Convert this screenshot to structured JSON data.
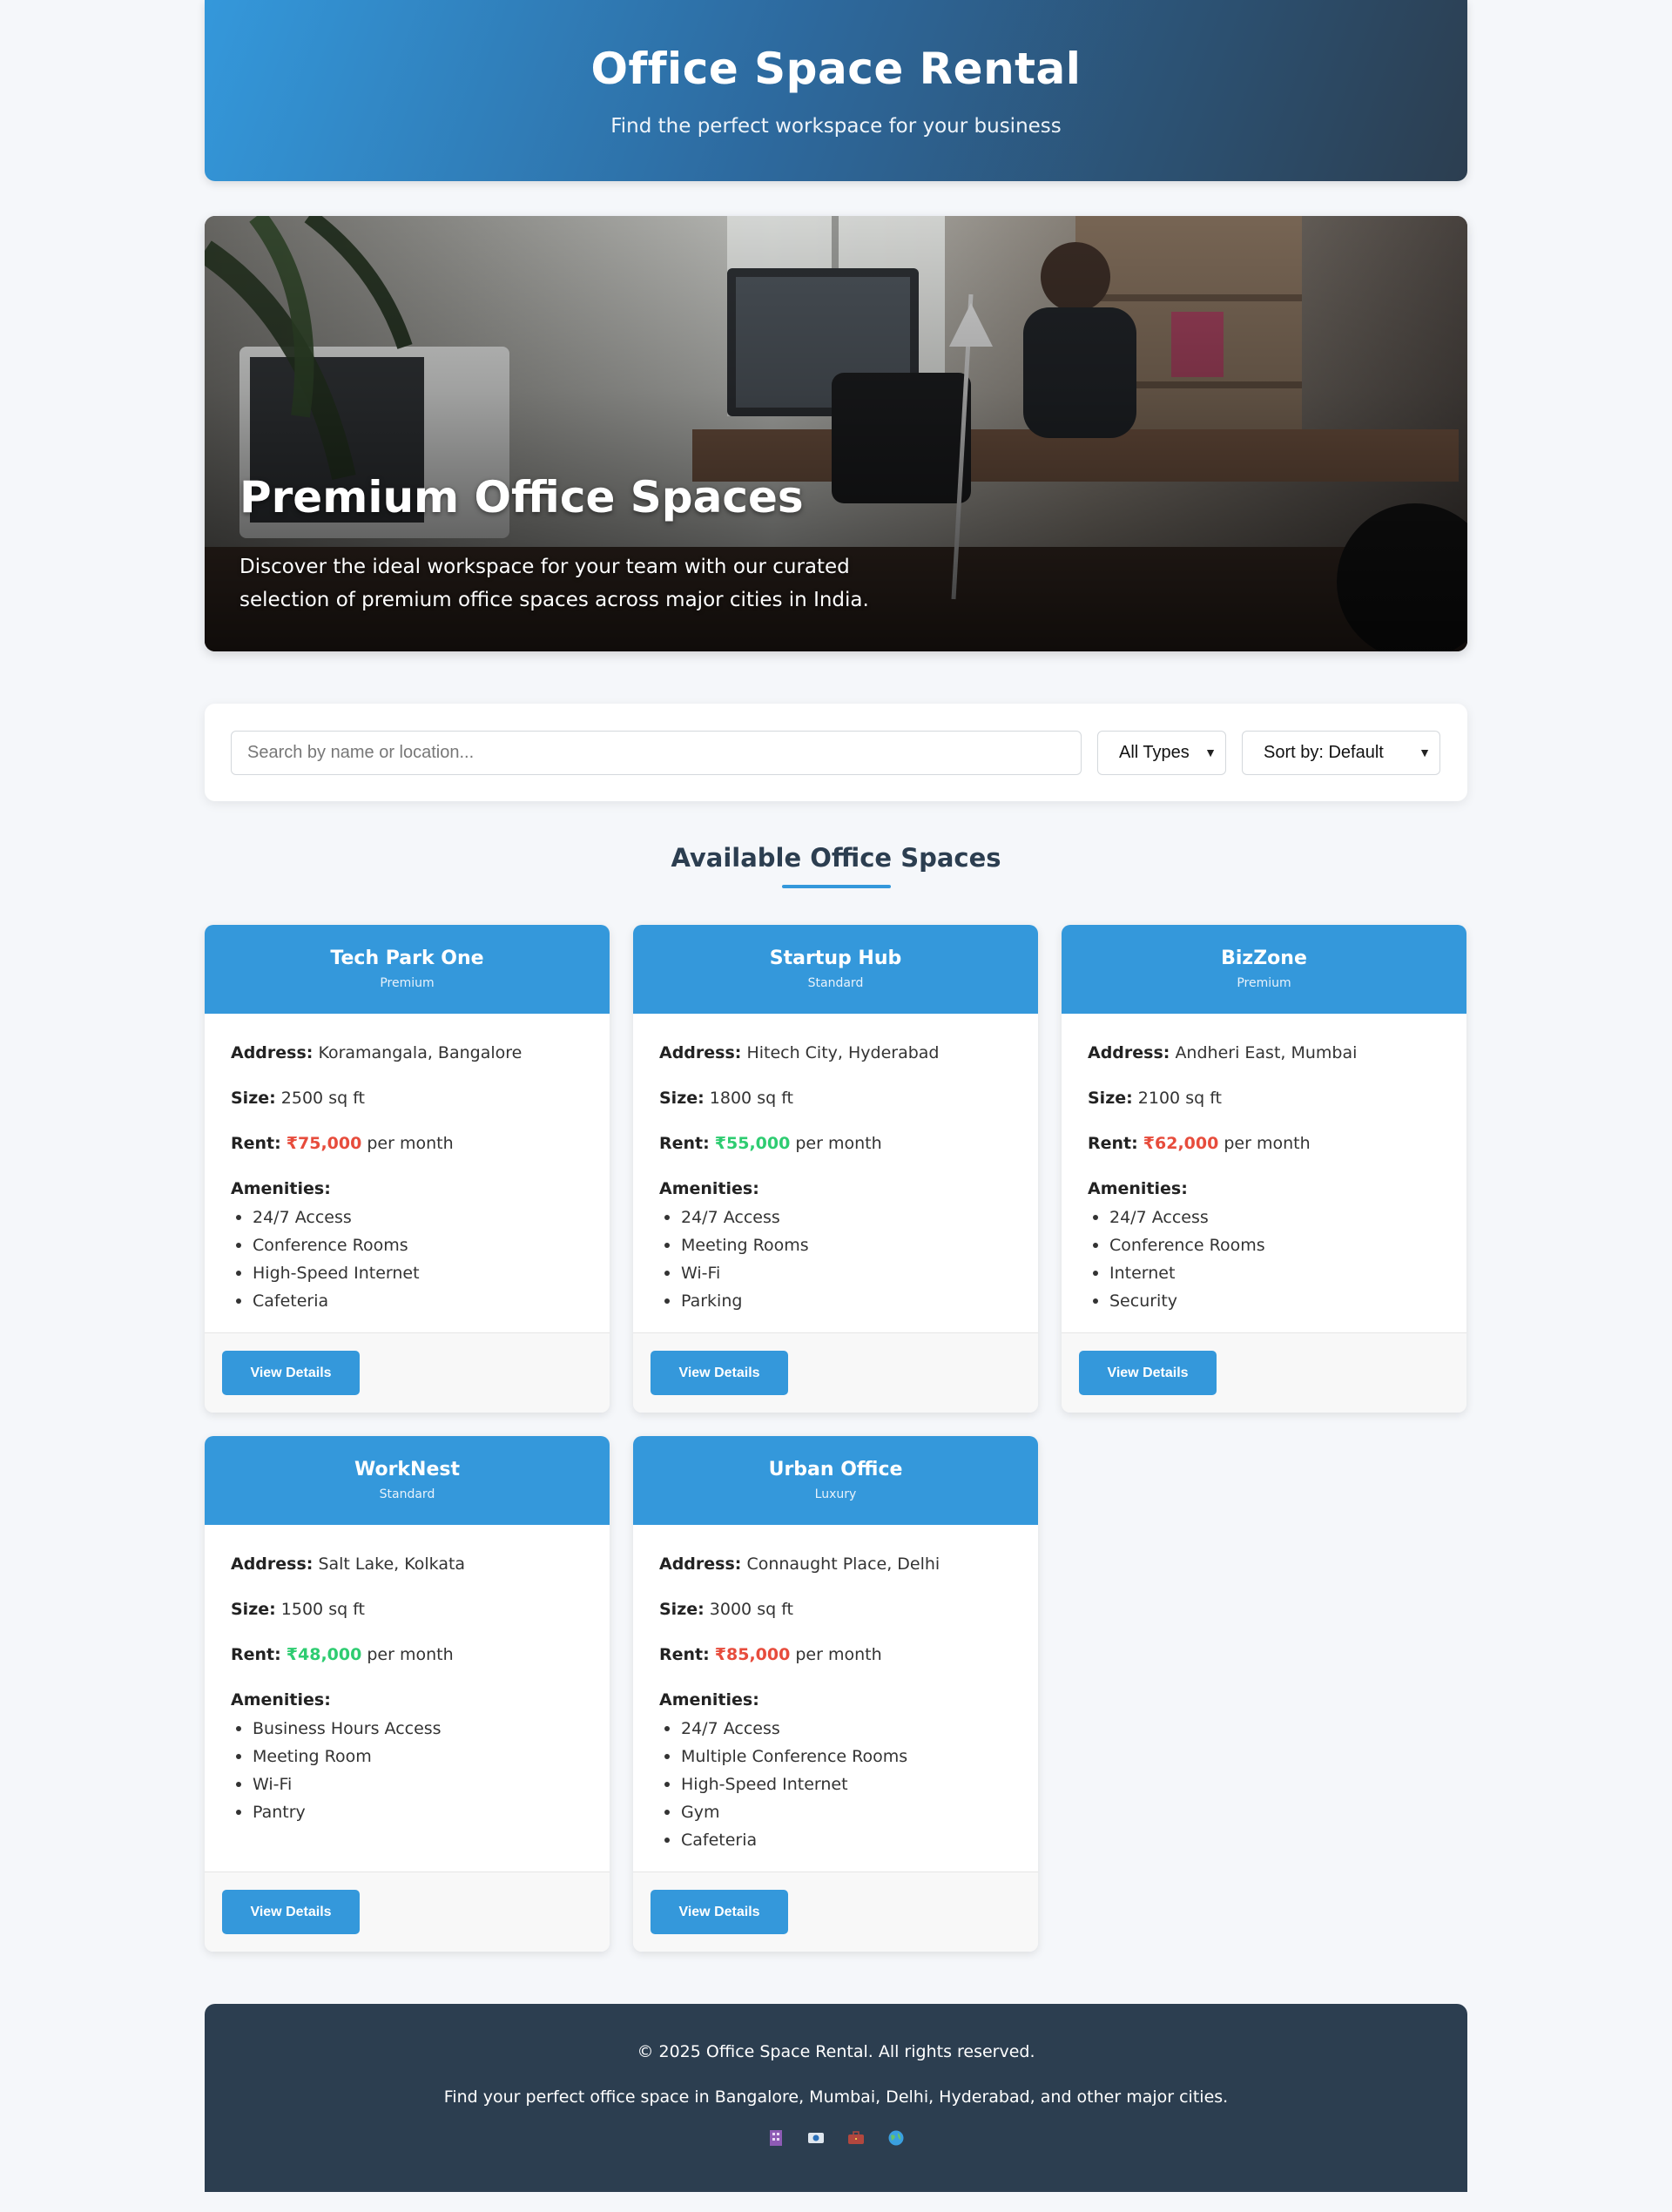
{
  "header": {
    "title": "Office Space Rental",
    "subtitle": "Find the perfect workspace for your business"
  },
  "hero": {
    "title": "Premium Office Spaces",
    "description": "Discover the ideal workspace for your team with our curated selection of premium office spaces across major cities in India."
  },
  "search": {
    "placeholder": "Search by name or location...",
    "type_filter": "All Types",
    "sort": "Sort by: Default"
  },
  "section": {
    "title": "Available Office Spaces"
  },
  "labels": {
    "address": "Address:",
    "size": "Size:",
    "rent": "Rent:",
    "per_month": "per month",
    "amenities": "Amenities:",
    "view_details": "View Details"
  },
  "listings": [
    {
      "name": "Tech Park One",
      "type": "Premium",
      "address": "Koramangala, Bangalore",
      "size": "2500 sq ft",
      "rent": "₹75,000",
      "rent_color": "#e74c3c",
      "amenities": [
        "24/7 Access",
        "Conference Rooms",
        "High-Speed Internet",
        "Cafeteria"
      ]
    },
    {
      "name": "Startup Hub",
      "type": "Standard",
      "address": "Hitech City, Hyderabad",
      "size": "1800 sq ft",
      "rent": "₹55,000",
      "rent_color": "#2ecc71",
      "amenities": [
        "24/7 Access",
        "Meeting Rooms",
        "Wi-Fi",
        "Parking"
      ]
    },
    {
      "name": "BizZone",
      "type": "Premium",
      "address": "Andheri East, Mumbai",
      "size": "2100 sq ft",
      "rent": "₹62,000",
      "rent_color": "#e74c3c",
      "amenities": [
        "24/7 Access",
        "Conference Rooms",
        "Internet",
        "Security"
      ]
    },
    {
      "name": "WorkNest",
      "type": "Standard",
      "address": "Salt Lake, Kolkata",
      "size": "1500 sq ft",
      "rent": "₹48,000",
      "rent_color": "#2ecc71",
      "amenities": [
        "Business Hours Access",
        "Meeting Room",
        "Wi-Fi",
        "Pantry"
      ]
    },
    {
      "name": "Urban Office",
      "type": "Luxury",
      "address": "Connaught Place, Delhi",
      "size": "3000 sq ft",
      "rent": "₹85,000",
      "rent_color": "#e74c3c",
      "amenities": [
        "24/7 Access",
        "Multiple Conference Rooms",
        "High-Speed Internet",
        "Gym",
        "Cafeteria"
      ]
    }
  ],
  "footer": {
    "copyright": "© 2025 Office Space Rental. All rights reserved.",
    "tagline": "Find your perfect office space in Bangalore, Mumbai, Delhi, Hyderabad, and other major cities.",
    "icons": [
      "building-icon",
      "id-card-icon",
      "briefcase-icon",
      "globe-icon"
    ]
  },
  "colors": {
    "accent": "#3498db",
    "dark": "#2c3e50",
    "price_high": "#e74c3c",
    "price_low": "#2ecc71"
  }
}
